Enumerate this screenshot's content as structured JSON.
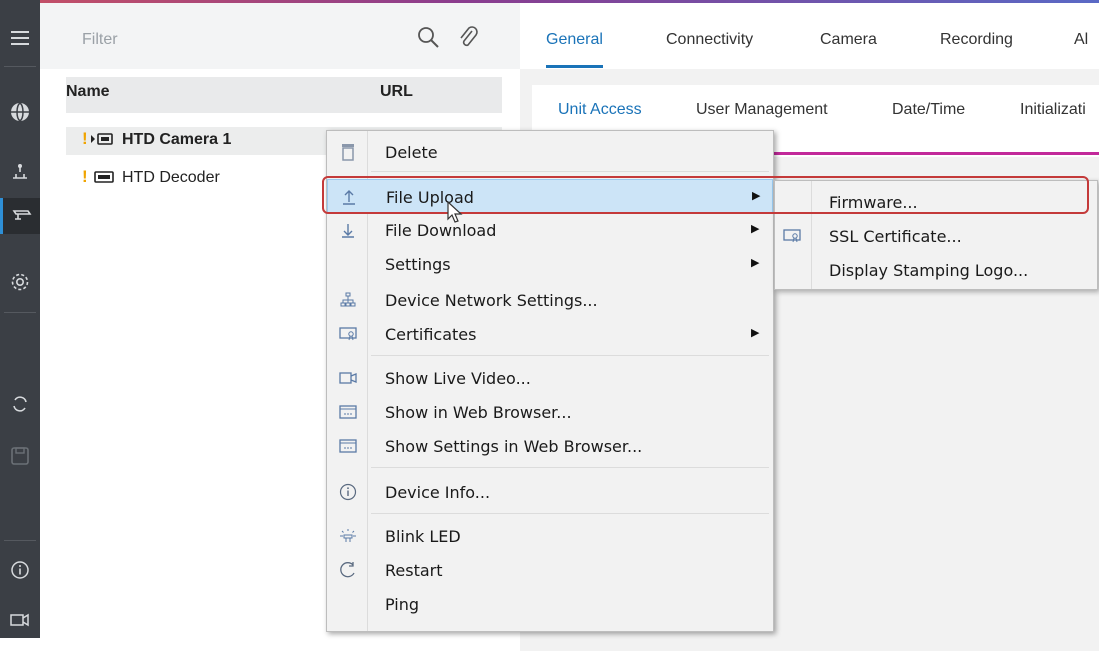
{
  "rail": {
    "items": [
      "menu-icon",
      "globe-icon",
      "network-scan-icon",
      "camera-icon",
      "settings-icon",
      "refresh-icon",
      "save-icon",
      "info-icon",
      "video-icon"
    ]
  },
  "list": {
    "filter_placeholder": "Filter",
    "columns": [
      "Name",
      "URL"
    ],
    "devices": [
      {
        "name": "HTD Camera 1",
        "selected": true
      },
      {
        "name": "HTD Decoder",
        "selected": false
      }
    ]
  },
  "tabs": [
    "General",
    "Connectivity",
    "Camera",
    "Recording",
    "Al"
  ],
  "subtabs": [
    "Unit Access",
    "User Management",
    "Date/Time",
    "Initializati"
  ],
  "context_menu": {
    "items": [
      {
        "label": "Delete",
        "icon": "trash-icon",
        "submenu": false
      },
      {
        "label": "File Upload",
        "icon": "upload-icon",
        "submenu": true,
        "highlighted": true
      },
      {
        "label": "File Download",
        "icon": "download-icon",
        "submenu": true
      },
      {
        "label": "Settings",
        "icon": "",
        "submenu": true
      },
      {
        "label": "Device Network Settings...",
        "icon": "network-icon",
        "submenu": false
      },
      {
        "label": "Certificates",
        "icon": "certificate-icon",
        "submenu": true
      },
      {
        "label": "Show Live Video...",
        "icon": "video-icon",
        "submenu": false
      },
      {
        "label": "Show in Web Browser...",
        "icon": "browser-icon",
        "submenu": false
      },
      {
        "label": "Show Settings in Web Browser...",
        "icon": "browser-icon",
        "submenu": false
      },
      {
        "label": "Device Info...",
        "icon": "info-icon",
        "submenu": false
      },
      {
        "label": "Blink LED",
        "icon": "led-icon",
        "submenu": false
      },
      {
        "label": "Restart",
        "icon": "restart-icon",
        "submenu": false
      },
      {
        "label": "Ping",
        "icon": "",
        "submenu": false
      }
    ]
  },
  "submenu": {
    "items": [
      {
        "label": "Firmware...",
        "icon": ""
      },
      {
        "label": "SSL Certificate...",
        "icon": "certificate-icon"
      },
      {
        "label": "Display Stamping Logo...",
        "icon": ""
      }
    ]
  },
  "colors": {
    "accent": "#1a73b8",
    "highlight": "#cce4f7",
    "outline": "#c43a3a",
    "warning": "#f0a400"
  }
}
